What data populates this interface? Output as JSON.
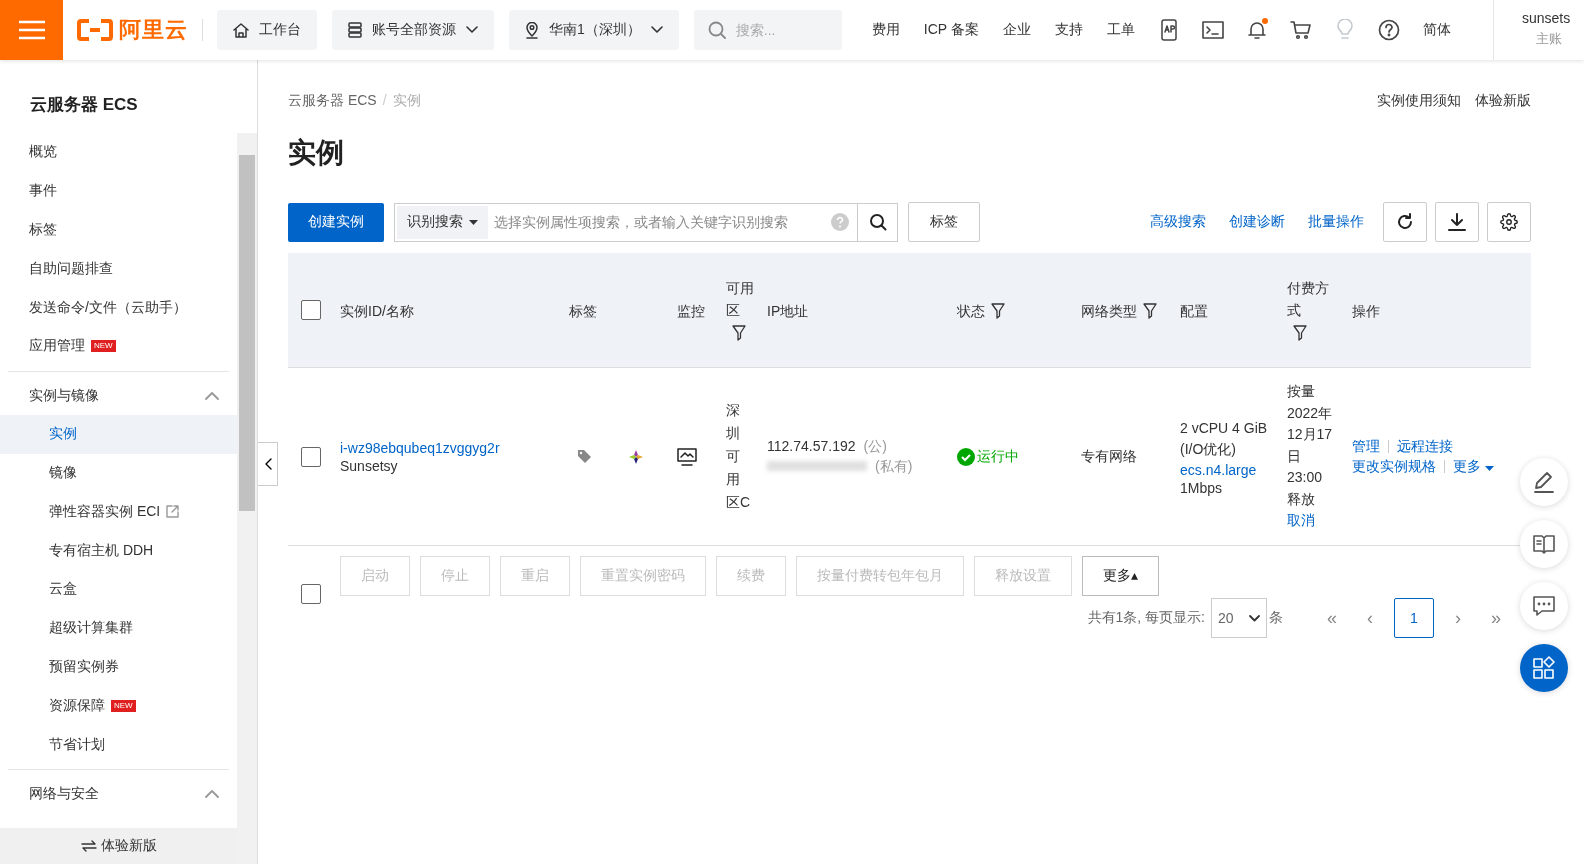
{
  "topbar": {
    "logo_text": "阿里云",
    "pills": [
      {
        "kind": "home",
        "label": "工作台",
        "dropdown": false
      },
      {
        "kind": "stack",
        "label": "账号全部资源",
        "dropdown": true
      },
      {
        "kind": "pin",
        "label": "华南1（深圳）",
        "dropdown": true
      }
    ],
    "search": {
      "placeholder": "搜索..."
    },
    "links": [
      "费用",
      "ICP 备案",
      "企业",
      "支持",
      "工单"
    ],
    "icons": [
      {
        "kind": "app",
        "dot": false,
        "disabled": false
      },
      {
        "kind": "terminal",
        "dot": false,
        "disabled": false
      },
      {
        "kind": "bell",
        "dot": true,
        "disabled": false
      },
      {
        "kind": "cart",
        "dot": false,
        "disabled": false
      },
      {
        "kind": "bulb",
        "dot": false,
        "disabled": true
      },
      {
        "kind": "help",
        "dot": false,
        "disabled": false
      }
    ],
    "language": "简体",
    "account": {
      "name": "sunsets",
      "role": "主账"
    }
  },
  "sidebar": {
    "title": "云服务器 ECS",
    "items": [
      {
        "label": "概览"
      },
      {
        "label": "事件"
      },
      {
        "label": "标签"
      },
      {
        "label": "自助问题排查"
      },
      {
        "label": "发送命令/文件（云助手）"
      },
      {
        "label": "应用管理",
        "badge": "NEW"
      }
    ],
    "groups": [
      {
        "label": "实例与镜像",
        "expanded": true,
        "children": [
          {
            "label": "实例",
            "selected": true,
            "external": false
          },
          {
            "label": "镜像",
            "selected": false,
            "external": false
          },
          {
            "label": "弹性容器实例 ECI",
            "selected": false,
            "external": true
          },
          {
            "label": "专有宿主机 DDH",
            "selected": false,
            "external": false
          },
          {
            "label": "云盒",
            "selected": false,
            "external": false
          },
          {
            "label": "超级计算集群",
            "selected": false,
            "external": false
          },
          {
            "label": "预留实例券",
            "selected": false,
            "external": false
          },
          {
            "label": "资源保障",
            "selected": false,
            "external": false,
            "badge": "NEW"
          },
          {
            "label": "节省计划",
            "selected": false,
            "external": false
          }
        ]
      },
      {
        "label": "网络与安全",
        "expanded": true
      }
    ],
    "footer": "体验新版"
  },
  "breadcrumb": [
    "云服务器 ECS",
    "实例"
  ],
  "breadcrumb_separator": "/",
  "header_links": [
    "实例使用须知",
    "体验新版"
  ],
  "page_title": "实例",
  "toolbar": {
    "create": "创建实例",
    "search_mode": "识别搜索",
    "search_placeholder": "选择实例属性项搜索，或者输入关键字识别搜索",
    "tag_button": "标签",
    "links": [
      "高级搜索",
      "创建诊断",
      "批量操作"
    ]
  },
  "table": {
    "all_checked": false,
    "columns": [
      {
        "label": "实例ID/名称",
        "filter": false
      },
      {
        "label": "标签",
        "filter": false
      },
      {
        "label": "监控",
        "filter": false
      },
      {
        "label": "可用区",
        "filter": true
      },
      {
        "label": "IP地址",
        "filter": false
      },
      {
        "label": "状态",
        "filter": true
      },
      {
        "label": "网络类型",
        "filter": true
      },
      {
        "label": "配置",
        "filter": false
      },
      {
        "label": "付费方式",
        "filter": true
      },
      {
        "label": "操作",
        "filter": false
      }
    ],
    "rows": [
      {
        "checked": false,
        "id": "i-wz98ebqubeq1zvggyg2r",
        "name": "Sunsetsy",
        "zone": "深圳可用区C",
        "ip_public": "112.74.57.192",
        "ip_public_tag": "(公)",
        "ip_private_tag": "(私有)",
        "status": "运行中",
        "network": "专有网络",
        "config_spec": "2 vCPU 4 GiB (I/O优化)",
        "config_type": "ecs.n4.large",
        "config_bandwidth": "1Mbps",
        "billing": "按量 2022年12月17日 23:00 释放",
        "billing_cancel": "取消",
        "actions": [
          "管理",
          "远程连接",
          "更改实例规格",
          "更多"
        ]
      }
    ]
  },
  "bulk": {
    "checked": false,
    "buttons": [
      {
        "label": "启动",
        "disabled": true
      },
      {
        "label": "停止",
        "disabled": true
      },
      {
        "label": "重启",
        "disabled": true
      },
      {
        "label": "重置实例密码",
        "disabled": true
      },
      {
        "label": "续费",
        "disabled": true
      },
      {
        "label": "按量付费转包年包月",
        "disabled": true
      },
      {
        "label": "释放设置",
        "disabled": true
      },
      {
        "label": "更多▴",
        "disabled": false
      }
    ]
  },
  "pagination": {
    "summary": "共有1条, 每页显示:",
    "page_size": "20",
    "unit": "条",
    "first": "«",
    "prev": "‹",
    "pages": [
      {
        "label": "1",
        "selected": true
      }
    ],
    "next": "›",
    "last": "»"
  },
  "float_buttons": [
    {
      "kind": "edit",
      "primary": false
    },
    {
      "kind": "book",
      "primary": false
    },
    {
      "kind": "chat",
      "primary": false
    },
    {
      "kind": "apps",
      "primary": true
    }
  ]
}
